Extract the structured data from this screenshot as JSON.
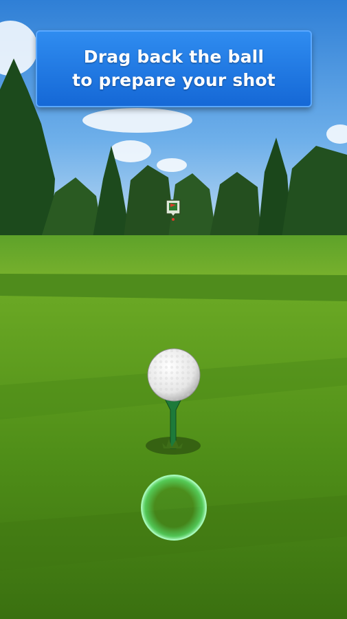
{
  "tutorial": {
    "line1": "Drag back the ball",
    "line2": "to prepare your shot"
  },
  "colors": {
    "banner": "#1f78e2",
    "sky_top": "#3c8ce0",
    "fairway": "#5e9e1e",
    "rough": "#3e7412",
    "aim_ring": "#5cff8a",
    "flag": "#e03a2a",
    "tee": "#1d7a3a"
  },
  "icons": {
    "hole": "flag-icon",
    "ball": "golf-ball",
    "aim": "aim-circle"
  }
}
